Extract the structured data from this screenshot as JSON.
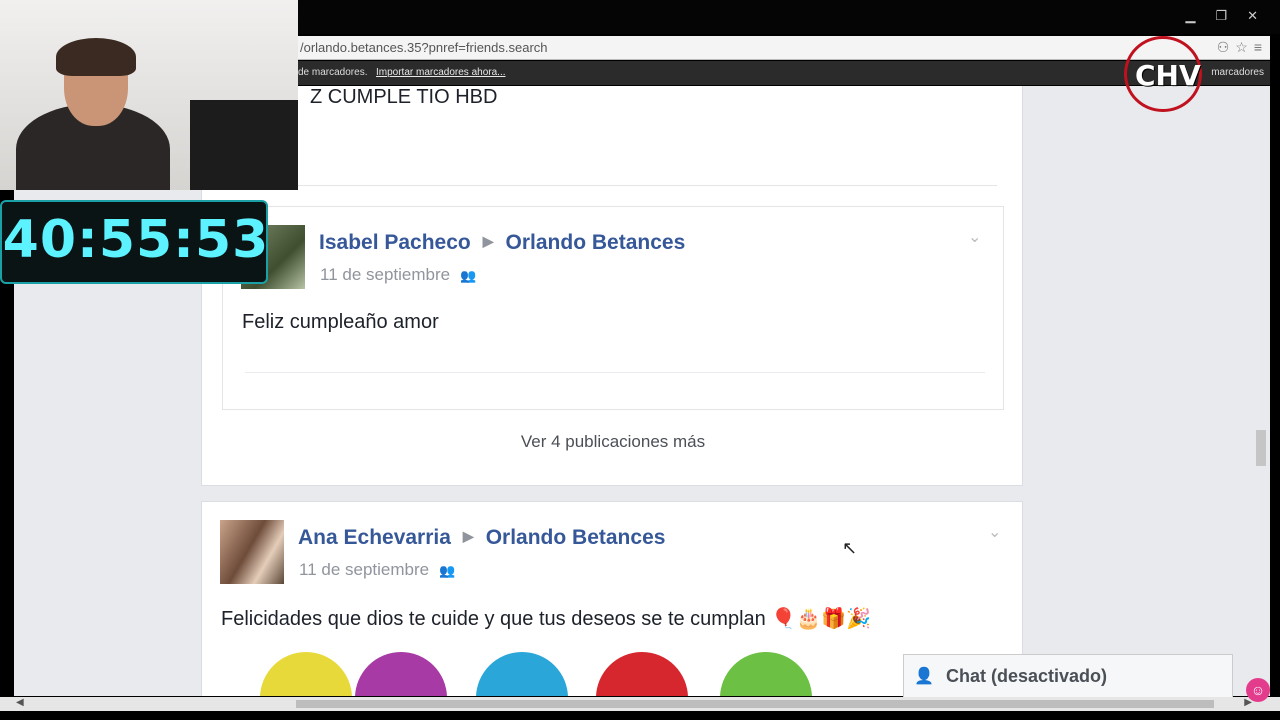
{
  "browser": {
    "url": "/orlando.betances.35?pnref=friends.search",
    "bookmarks_left": "de marcadores.",
    "bookmarks_link": "Importar marcadores ahora...",
    "bookmarks_right": "marcadores"
  },
  "overlay": {
    "timer": "40:55:53",
    "logo": "CHV"
  },
  "feed": {
    "partial_post_text": "Z CUMPLE TIO HBD",
    "post1": {
      "author": "Isabel Pacheco",
      "target": "Orlando Betances",
      "date": "11 de septiembre",
      "text": "Feliz cumpleaño amor"
    },
    "more_link": "Ver 4 publicaciones más",
    "post2": {
      "author": "Ana Echevarria",
      "target": "Orlando Betances",
      "date": "11 de septiembre",
      "text": "Felicidades que dios te cuide y que tus deseos se te cumplan 🎈🎂🎁🎉"
    }
  },
  "chat": {
    "label": "Chat (desactivado)"
  },
  "colors": {
    "link": "#365899",
    "timer": "#5df2ff",
    "logo_ring": "#c0111f"
  }
}
